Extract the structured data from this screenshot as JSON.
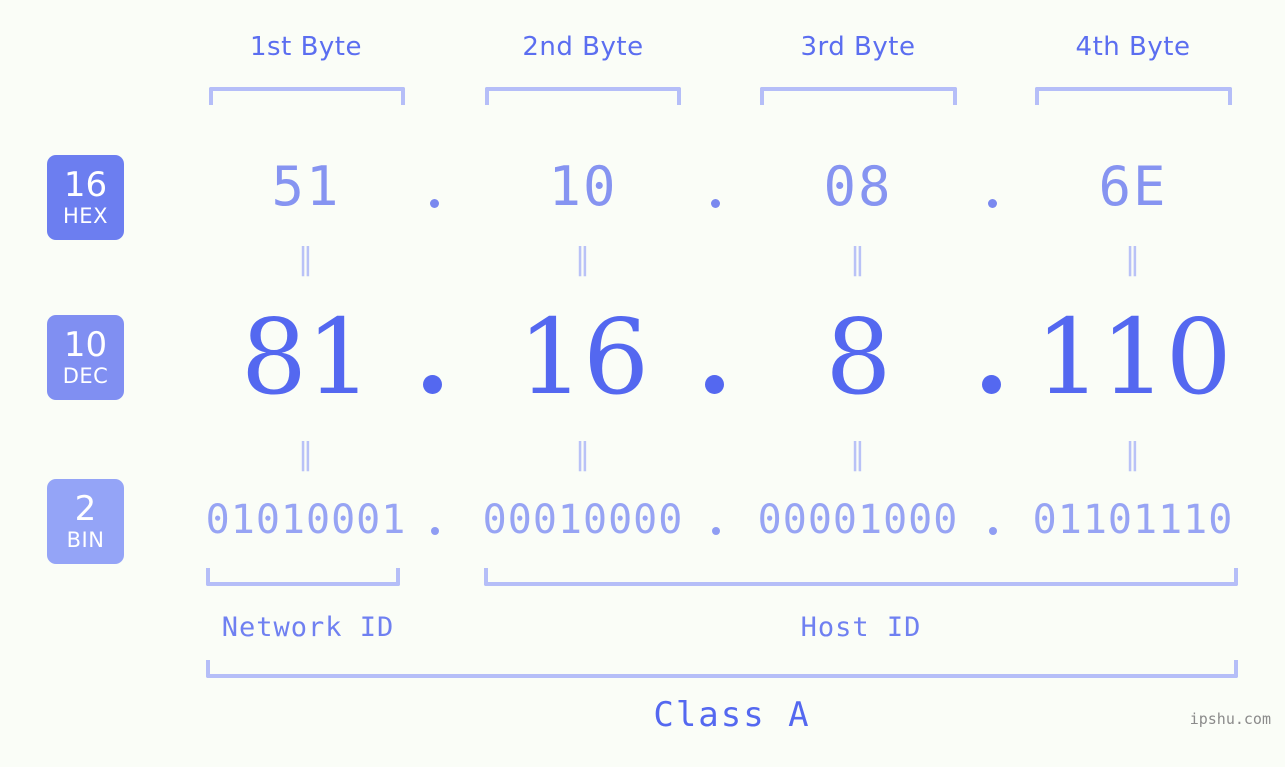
{
  "page": {
    "background_color": "#fafdf7",
    "watermark": "ipshu.com"
  },
  "colors": {
    "hex_text": "#8694f1",
    "dec_text": "#5468f0",
    "bin_text": "#97a4f4",
    "bracket": "#b5bef8",
    "header_text": "#5b6ef0",
    "badge_hex": "#6c7ef0",
    "badge_dec": "#808ff2",
    "badge_bin": "#94a4f7",
    "equals_mark": "#b9c2f7",
    "watermark": "#8b8b8b"
  },
  "byte_headers": [
    {
      "label": "1st Byte"
    },
    {
      "label": "2nd Byte"
    },
    {
      "label": "3rd Byte"
    },
    {
      "label": "4th Byte"
    }
  ],
  "base_badges": [
    {
      "number": "16",
      "label": "HEX"
    },
    {
      "number": "10",
      "label": "DEC"
    },
    {
      "number": "2",
      "label": "BIN"
    }
  ],
  "rows": {
    "hex": {
      "values": [
        "51",
        "10",
        "08",
        "6E"
      ],
      "separator": "."
    },
    "dec": {
      "values": [
        "81",
        "16",
        "8",
        "110"
      ],
      "separator": "."
    },
    "bin": {
      "values": [
        "01010001",
        "00010000",
        "00001000",
        "01101110"
      ],
      "separator": "."
    }
  },
  "equals_marks": {
    "glyph": "‖",
    "count_per_row": 4
  },
  "sections": [
    {
      "label": "Network ID"
    },
    {
      "label": "Host ID"
    }
  ],
  "class_label": "Class A"
}
